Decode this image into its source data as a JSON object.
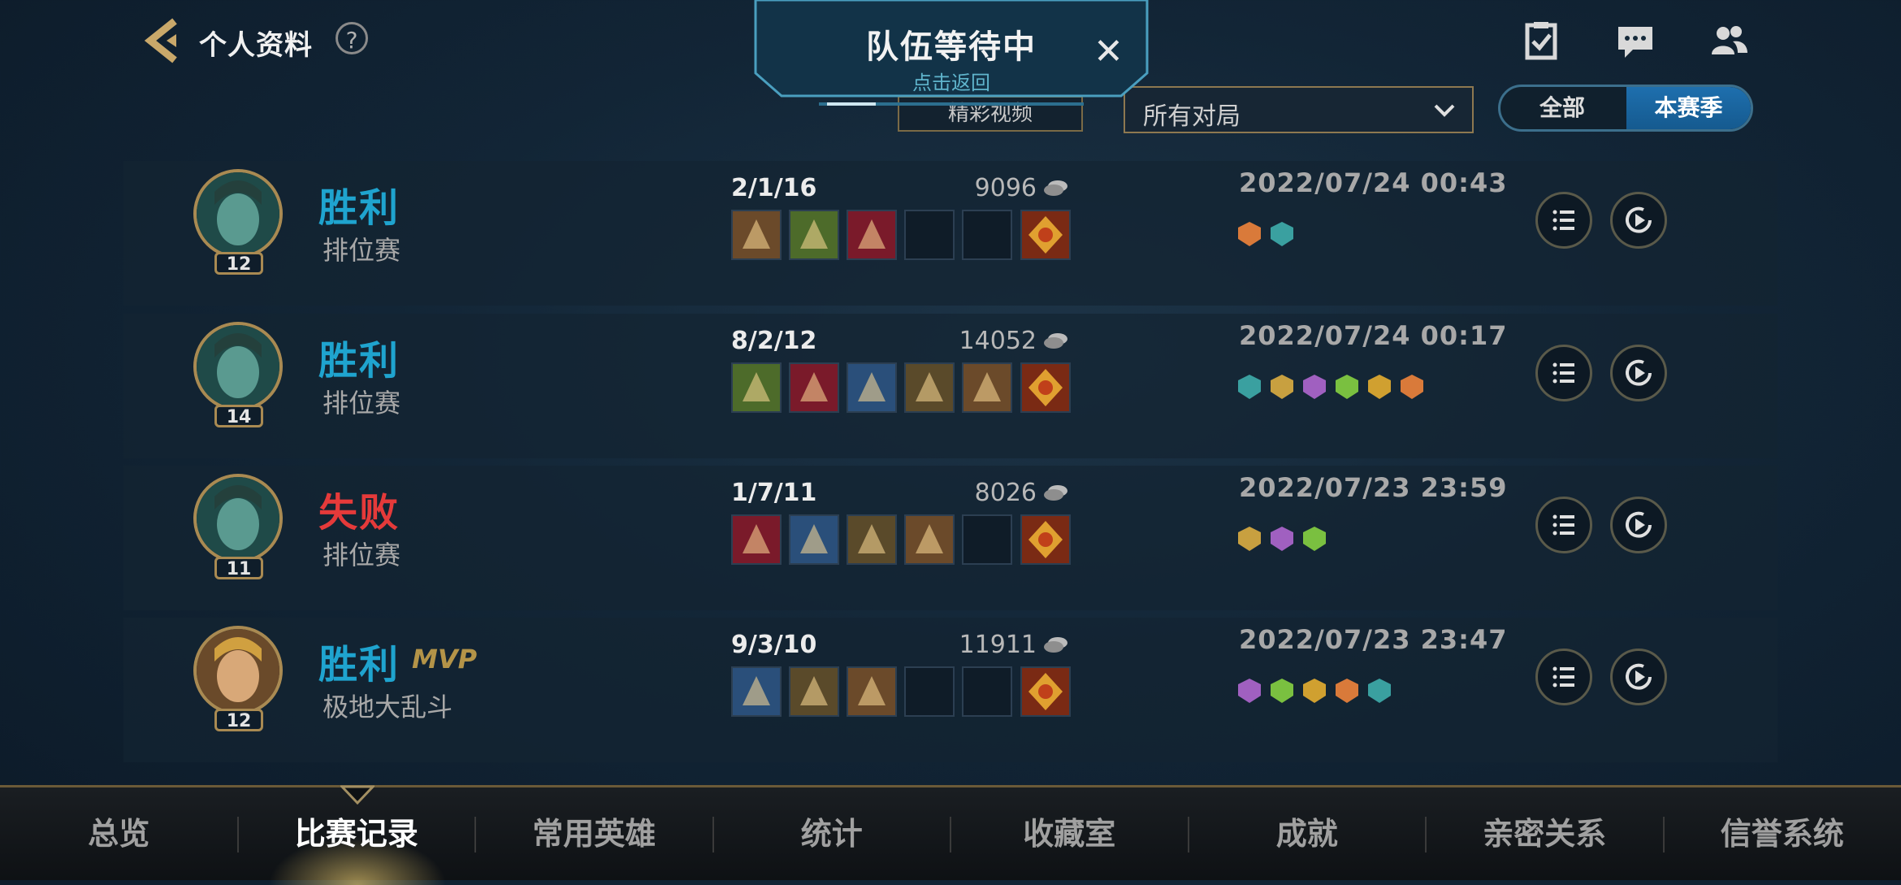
{
  "header": {
    "title": "个人资料",
    "help_icon": "question-mark-icon",
    "help_symbol": "?"
  },
  "queue": {
    "title": "队伍等待中",
    "subtitle": "点击返回",
    "close_symbol": "✕"
  },
  "filters": {
    "hidden_button_label": "精彩视频",
    "dropdown_value": "所有对局",
    "toggle": {
      "all": "全部",
      "season": "本赛季",
      "selected": "season"
    }
  },
  "colors": {
    "win": "#1fa4cf",
    "loss": "#e53a3a",
    "gold_accent": "#a98a52"
  },
  "matches": [
    {
      "result": "胜利",
      "outcome": "win",
      "mvp": "",
      "mode": "排位赛",
      "level": "12",
      "kda": "2/1/16",
      "gold": "9096",
      "date": "2022/07/24 00:43",
      "items_filled": 3
    },
    {
      "result": "胜利",
      "outcome": "win",
      "mvp": "",
      "mode": "排位赛",
      "level": "14",
      "kda": "8/2/12",
      "gold": "14052",
      "date": "2022/07/24 00:17",
      "items_filled": 5
    },
    {
      "result": "失败",
      "outcome": "loss",
      "mvp": "",
      "mode": "排位赛",
      "level": "11",
      "kda": "1/7/11",
      "gold": "8026",
      "date": "2022/07/23 23:59",
      "items_filled": 4
    },
    {
      "result": "胜利",
      "outcome": "win",
      "mvp": "MVP",
      "mode": "极地大乱斗",
      "level": "12",
      "kda": "9/3/10",
      "gold": "11911",
      "date": "2022/07/23 23:47",
      "items_filled": 3
    }
  ],
  "nav": {
    "items": [
      "总览",
      "比赛记录",
      "常用英雄",
      "统计",
      "收藏室",
      "成就",
      "亲密关系",
      "信誉系统"
    ],
    "active": "比赛记录"
  }
}
